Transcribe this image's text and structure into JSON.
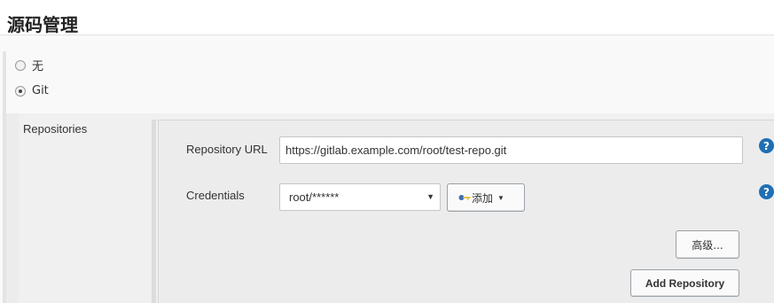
{
  "section": {
    "title": "源码管理"
  },
  "scm_options": [
    {
      "label": "无",
      "checked": false
    },
    {
      "label": "Git",
      "checked": true
    }
  ],
  "repositories": {
    "label": "Repositories",
    "url_label": "Repository URL",
    "url_value": "https://gitlab.example.com/root/test-repo.git",
    "credentials_label": "Credentials",
    "credentials_selected": "root/******",
    "add_button_label": "添加",
    "advanced_button_label": "高级...",
    "add_repository_label": "Add Repository"
  },
  "help": {
    "glyph": "?"
  },
  "colors": {
    "help_icon": "#1f6fb5",
    "key_icon_blue": "#3b6fb6",
    "key_icon_yellow": "#e8c44a"
  }
}
